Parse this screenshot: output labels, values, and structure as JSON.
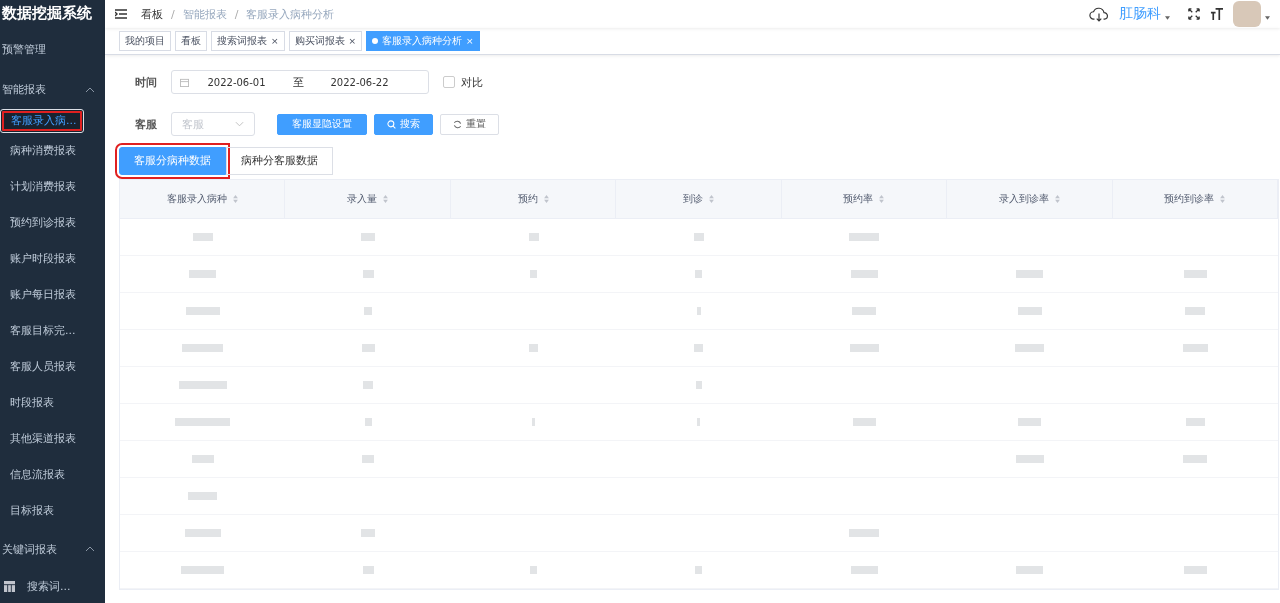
{
  "app": {
    "title": "数据挖掘系统"
  },
  "sidebar": {
    "items": [
      {
        "label": "预警管理",
        "kind": "link"
      },
      {
        "label": "智能报表",
        "kind": "group",
        "expanded": true,
        "children": [
          {
            "label": "客服录入病...",
            "selected": true,
            "highlighted": true
          },
          {
            "label": "病种消费报表",
            "selected": false,
            "highlighted": false
          },
          {
            "label": "计划消费报表",
            "selected": false,
            "highlighted": false
          },
          {
            "label": "预约到诊报表",
            "selected": false,
            "highlighted": false
          },
          {
            "label": "账户时段报表",
            "selected": false,
            "highlighted": false
          },
          {
            "label": "账户每日报表",
            "selected": false,
            "highlighted": false
          },
          {
            "label": "客服目标完...",
            "selected": false,
            "highlighted": false
          },
          {
            "label": "客服人员报表",
            "selected": false,
            "highlighted": false
          },
          {
            "label": "时段报表",
            "selected": false,
            "highlighted": false
          },
          {
            "label": "其他渠道报表",
            "selected": false,
            "highlighted": false
          },
          {
            "label": "信息流报表",
            "selected": false,
            "highlighted": false
          },
          {
            "label": "目标报表",
            "selected": false,
            "highlighted": false
          }
        ]
      },
      {
        "label": "关键词报表",
        "kind": "group",
        "expanded": true
      },
      {
        "label": "搜索词...",
        "kind": "item"
      }
    ]
  },
  "breadcrumb": [
    "看板",
    "智能报表",
    "客服录入病种分析"
  ],
  "breadcrumb_separator": "/",
  "header": {
    "department": "肛肠科"
  },
  "tabs": [
    {
      "label": "我的项目",
      "selected": false
    },
    {
      "label": "看板",
      "selected": false
    },
    {
      "label": "搜索词报表",
      "selected": false,
      "close": "×"
    },
    {
      "label": "购买词报表",
      "selected": false,
      "close": "×"
    },
    {
      "label": "客服录入病种分析",
      "selected": true,
      "close": "×"
    }
  ],
  "filters": {
    "time_label": "时间",
    "start_date": "2022-06-01",
    "separator": "至",
    "end_date": "2022-06-22",
    "compare": {
      "label": "对比",
      "checked": false
    },
    "agent_label": "客服",
    "agent_placeholder": "客服"
  },
  "buttons": [
    {
      "label": "客服显隐设置",
      "kind": "primary"
    },
    {
      "label": "搜索",
      "kind": "search"
    },
    {
      "label": "重置",
      "kind": "reset"
    }
  ],
  "view_tabs": [
    {
      "label": "客服分病种数据",
      "selected": true,
      "highlighted": true
    },
    {
      "label": "病种分客服数据",
      "selected": false,
      "highlighted": false
    }
  ],
  "table": {
    "columns": [
      "客服录入病种",
      "录入量",
      "预约",
      "到诊",
      "预约率",
      "录入到诊率",
      "预约到诊率"
    ]
  }
}
